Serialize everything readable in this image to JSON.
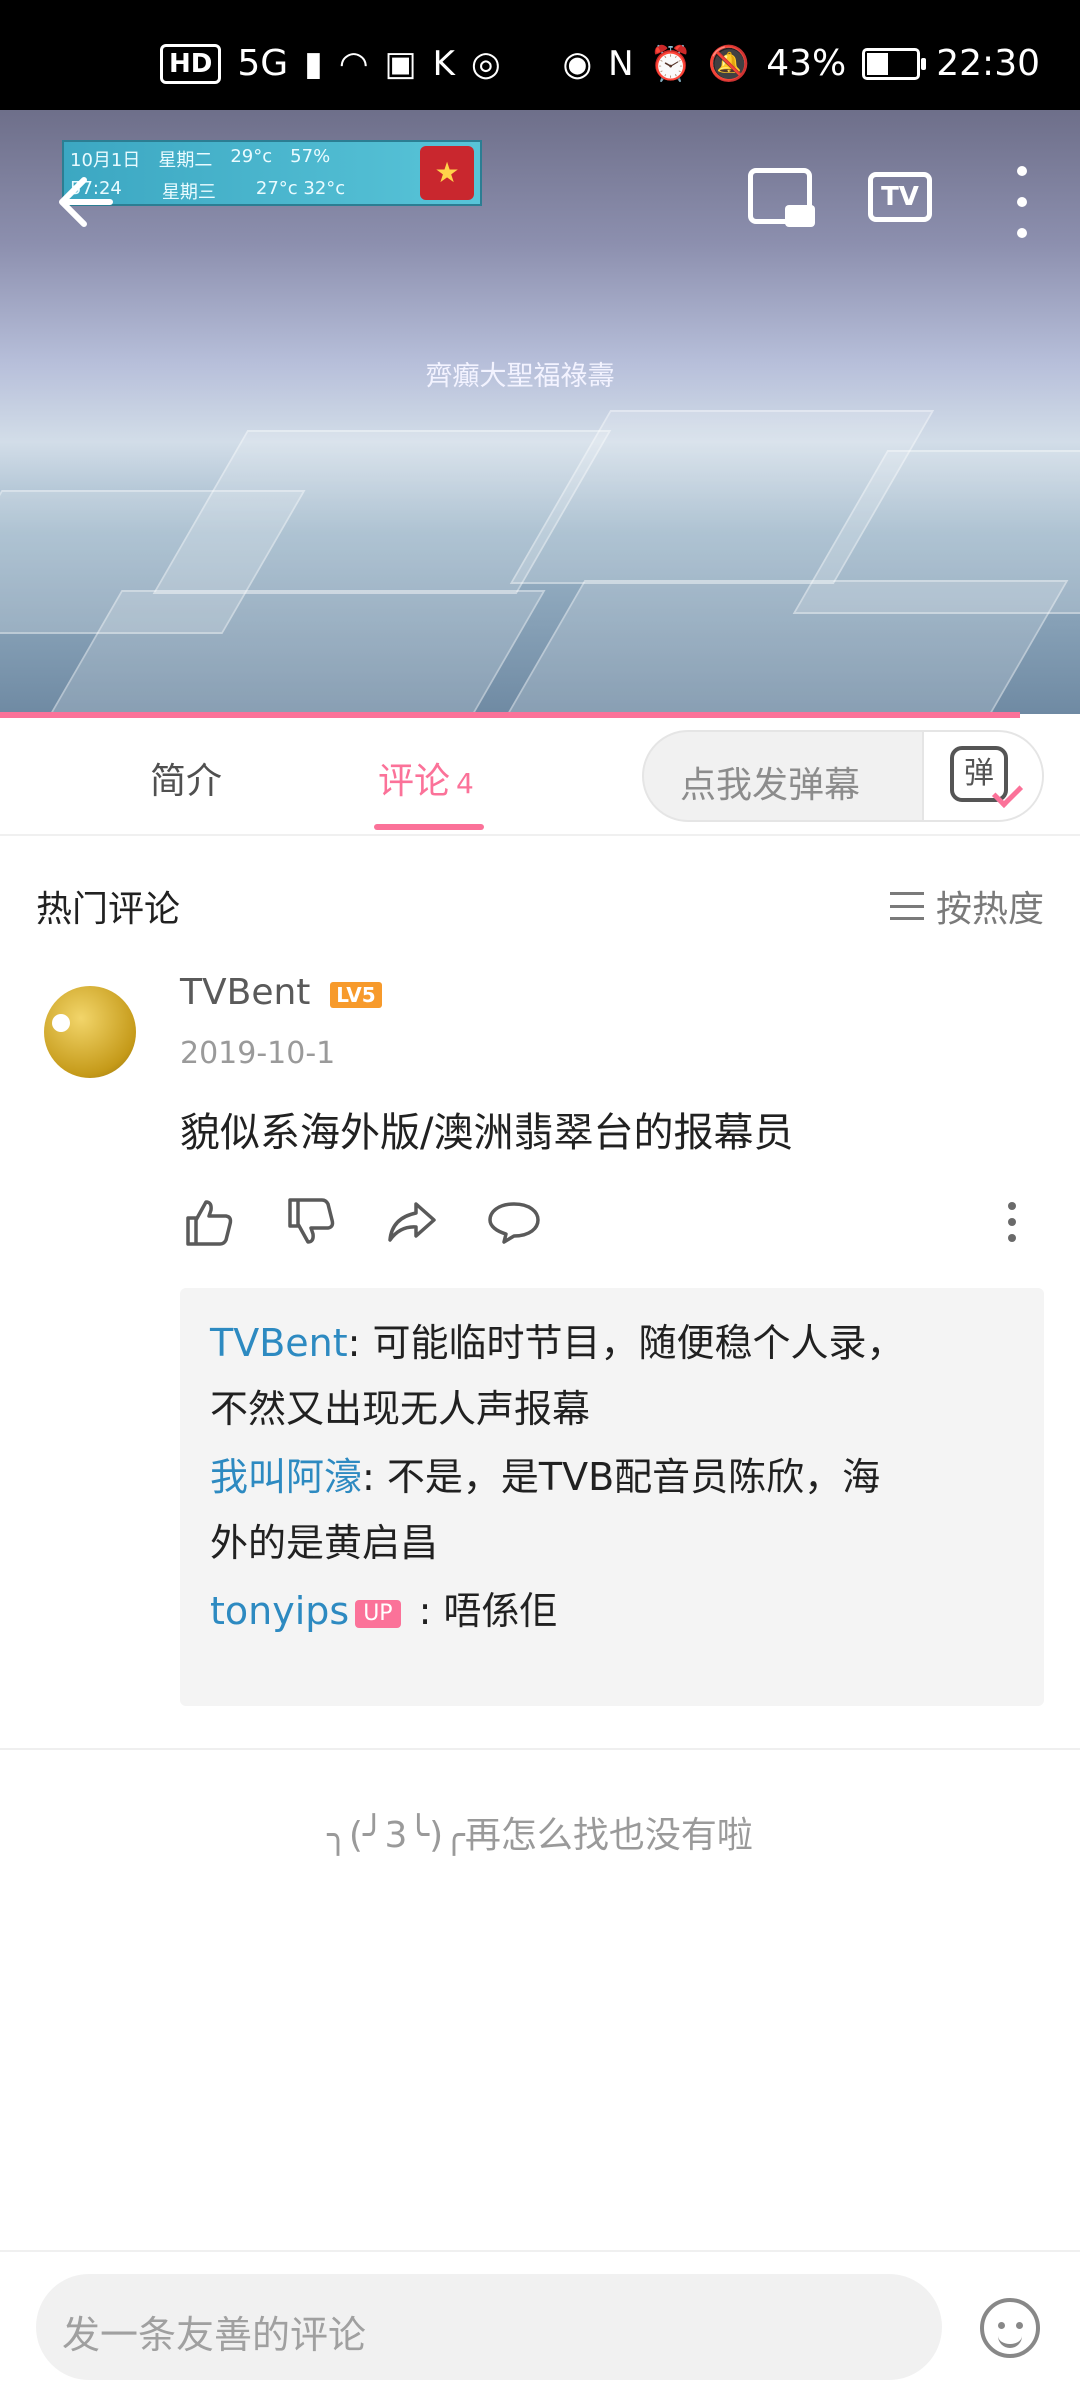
{
  "status_bar": {
    "network_badge": "HD",
    "network_type": "5G",
    "battery_text": "43%",
    "time": "22:30"
  },
  "video": {
    "caption": "齊癲大聖福祿壽",
    "ticker_date": "10月1日",
    "ticker_weekday": "星期二",
    "ticker_temp": "29°c",
    "ticker_humidity": "57%",
    "ticker_time": "57:24",
    "ticker_next_day": "星期三",
    "ticker_next_temp": "27°c 32°c",
    "icons": [
      "back-arrow-icon",
      "picture-in-picture-icon",
      "tv-cast-icon",
      "more-vertical-icon"
    ],
    "tv_label": "TV"
  },
  "tabs": {
    "intro": "简介",
    "comments_label": "评论",
    "comments_count": "4",
    "danmaku_placeholder": "点我发弹幕",
    "danmaku_icon_char": "弹"
  },
  "comments_section": {
    "header": "热门评论",
    "sort_label": "按热度"
  },
  "comment": {
    "username": "TVBent",
    "level": "LV5",
    "date": "2019-10-1",
    "content": "貌似系海外版/澳洲翡翠台的报幕员",
    "replies": [
      {
        "name": "TVBent",
        "sep": ": ",
        "text_line1": "可能临时节目，随便稳个人录，",
        "text_line2": "不然又出现无人声报幕"
      },
      {
        "name": "我叫阿濠",
        "sep": ": ",
        "text_line1": "不是，是TVB配音员陈欣，海",
        "text_line2": "外的是黄启昌"
      },
      {
        "name": "tonyips",
        "badge": "UP",
        "sep": " : ",
        "text_line1": "唔係佢"
      }
    ]
  },
  "end_message": "╮(╯3╰)╭再怎么找也没有啦",
  "bottom": {
    "comment_placeholder": "发一条友善的评论"
  },
  "colors": {
    "accent": "#fb7299",
    "link": "#2d8ac1",
    "level_badge": "#f79a2b"
  }
}
